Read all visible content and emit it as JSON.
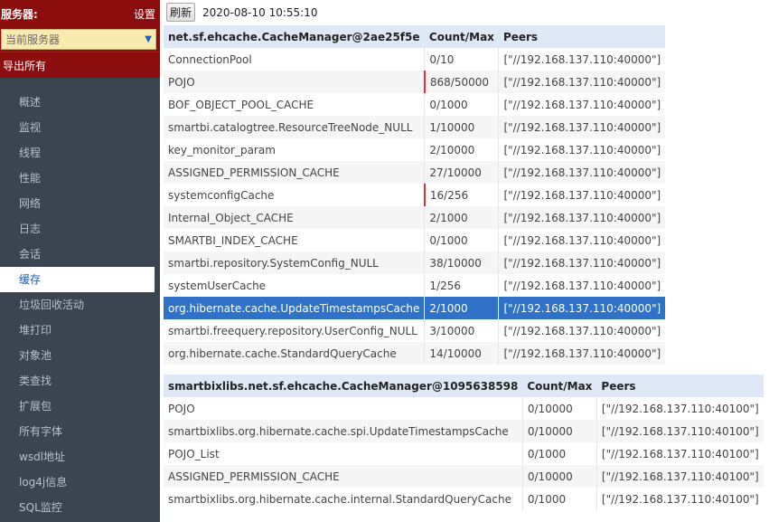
{
  "sidebar": {
    "title": "服务器:",
    "settings": "设置",
    "server_select": "当前服务器",
    "export_all": "导出所有",
    "nav": [
      "概述",
      "监视",
      "线程",
      "性能",
      "网络",
      "日志",
      "会话",
      "缓存",
      "垃圾回收活动",
      "堆打印",
      "对象池",
      "类查找",
      "扩展包",
      "所有字体",
      "wsdl地址",
      "log4j信息",
      "SQL监控"
    ],
    "active_index": 7
  },
  "toolbar": {
    "refresh": "刷新",
    "timestamp": "2020-08-10 10:55:10"
  },
  "tables": [
    {
      "headers": [
        "net.sf.ehcache.CacheManager@2ae25f5e",
        "Count/Max",
        "Peers"
      ],
      "rows": [
        [
          "ConnectionPool",
          "0/10",
          "[\"//192.168.137.110:40000\"]"
        ],
        [
          "POJO",
          "868/50000",
          "[\"//192.168.137.110:40000\"]"
        ],
        [
          "BOF_OBJECT_POOL_CACHE",
          "0/1000",
          "[\"//192.168.137.110:40000\"]"
        ],
        [
          "smartbi.catalogtree.ResourceTreeNode_NULL",
          "1/10000",
          "[\"//192.168.137.110:40000\"]"
        ],
        [
          "key_monitor_param",
          "2/10000",
          "[\"//192.168.137.110:40000\"]"
        ],
        [
          "ASSIGNED_PERMISSION_CACHE",
          "27/10000",
          "[\"//192.168.137.110:40000\"]"
        ],
        [
          "systemconfigCache",
          "16/256",
          "[\"//192.168.137.110:40000\"]"
        ],
        [
          "Internal_Object_CACHE",
          "2/1000",
          "[\"//192.168.137.110:40000\"]"
        ],
        [
          "SMARTBI_INDEX_CACHE",
          "0/1000",
          "[\"//192.168.137.110:40000\"]"
        ],
        [
          "smartbi.repository.SystemConfig_NULL",
          "38/10000",
          "[\"//192.168.137.110:40000\"]"
        ],
        [
          "systemUserCache",
          "1/256",
          "[\"//192.168.137.110:40000\"]"
        ],
        [
          "org.hibernate.cache.UpdateTimestampsCache",
          "2/1000",
          "[\"//192.168.137.110:40000\"]"
        ],
        [
          "smartbi.freequery.repository.UserConfig_NULL",
          "3/10000",
          "[\"//192.168.137.110:40000\"]"
        ],
        [
          "org.hibernate.cache.StandardQueryCache",
          "14/10000",
          "[\"//192.168.137.110:40000\"]"
        ]
      ],
      "selected_row": 11,
      "warn_rows": [
        1,
        6
      ]
    },
    {
      "headers": [
        "smartbixlibs.net.sf.ehcache.CacheManager@1095638598",
        "Count/Max",
        "Peers"
      ],
      "rows": [
        [
          "POJO",
          "0/10000",
          "[\"//192.168.137.110:40100\"]"
        ],
        [
          "smartbixlibs.org.hibernate.cache.spi.UpdateTimestampsCache",
          "0/10000",
          "[\"//192.168.137.110:40100\"]"
        ],
        [
          "POJO_List",
          "0/1000",
          "[\"//192.168.137.110:40100\"]"
        ],
        [
          "ASSIGNED_PERMISSION_CACHE",
          "0/10000",
          "[\"//192.168.137.110:40100\"]"
        ],
        [
          "smartbixlibs.org.hibernate.cache.internal.StandardQueryCache",
          "0/1000",
          "[\"//192.168.137.110:40100\"]"
        ]
      ],
      "selected_row": -1,
      "warn_rows": []
    }
  ]
}
